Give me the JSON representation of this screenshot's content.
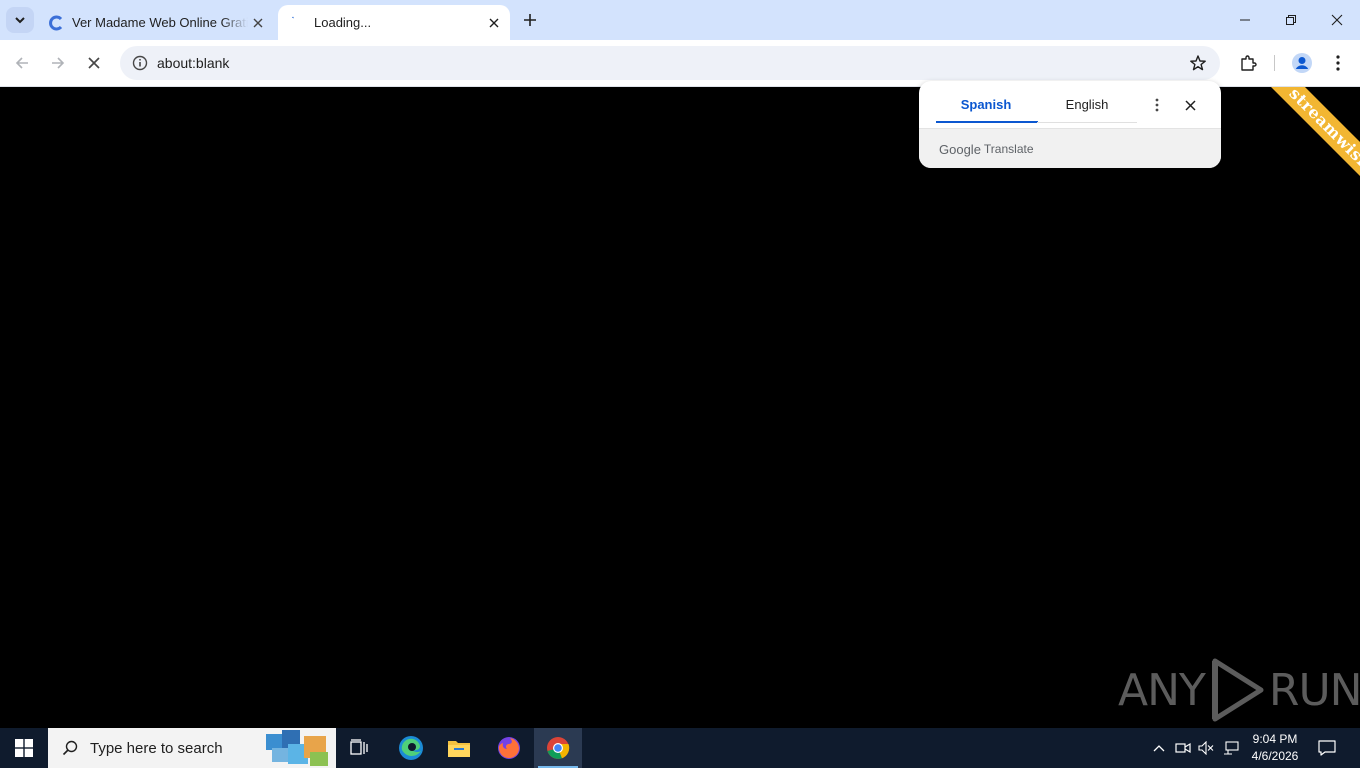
{
  "browser": {
    "tabs": [
      {
        "title": "Ver Madame Web Online Gratis",
        "favicon": "cuevana-icon",
        "active": false
      },
      {
        "title": "Loading...",
        "favicon": "loading-spinner-icon",
        "active": true
      }
    ],
    "address": {
      "url": "about:blank"
    }
  },
  "translate_popup": {
    "source_lang": "Spanish",
    "target_lang": "English",
    "brand": "Google",
    "brand_suffix": "Translate"
  },
  "page": {
    "ribbon_text": "streamwish",
    "watermark_left": "ANY",
    "watermark_right": "RUN"
  },
  "taskbar": {
    "search_placeholder": "Type here to search",
    "time": "9:04 PM",
    "date": "4/6/2026"
  },
  "colors": {
    "tabstrip_bg": "#d3e3fd",
    "accent_blue": "#0b57d0",
    "ribbon": "#f2b632",
    "taskbar_bg": "#0f1b2d"
  }
}
